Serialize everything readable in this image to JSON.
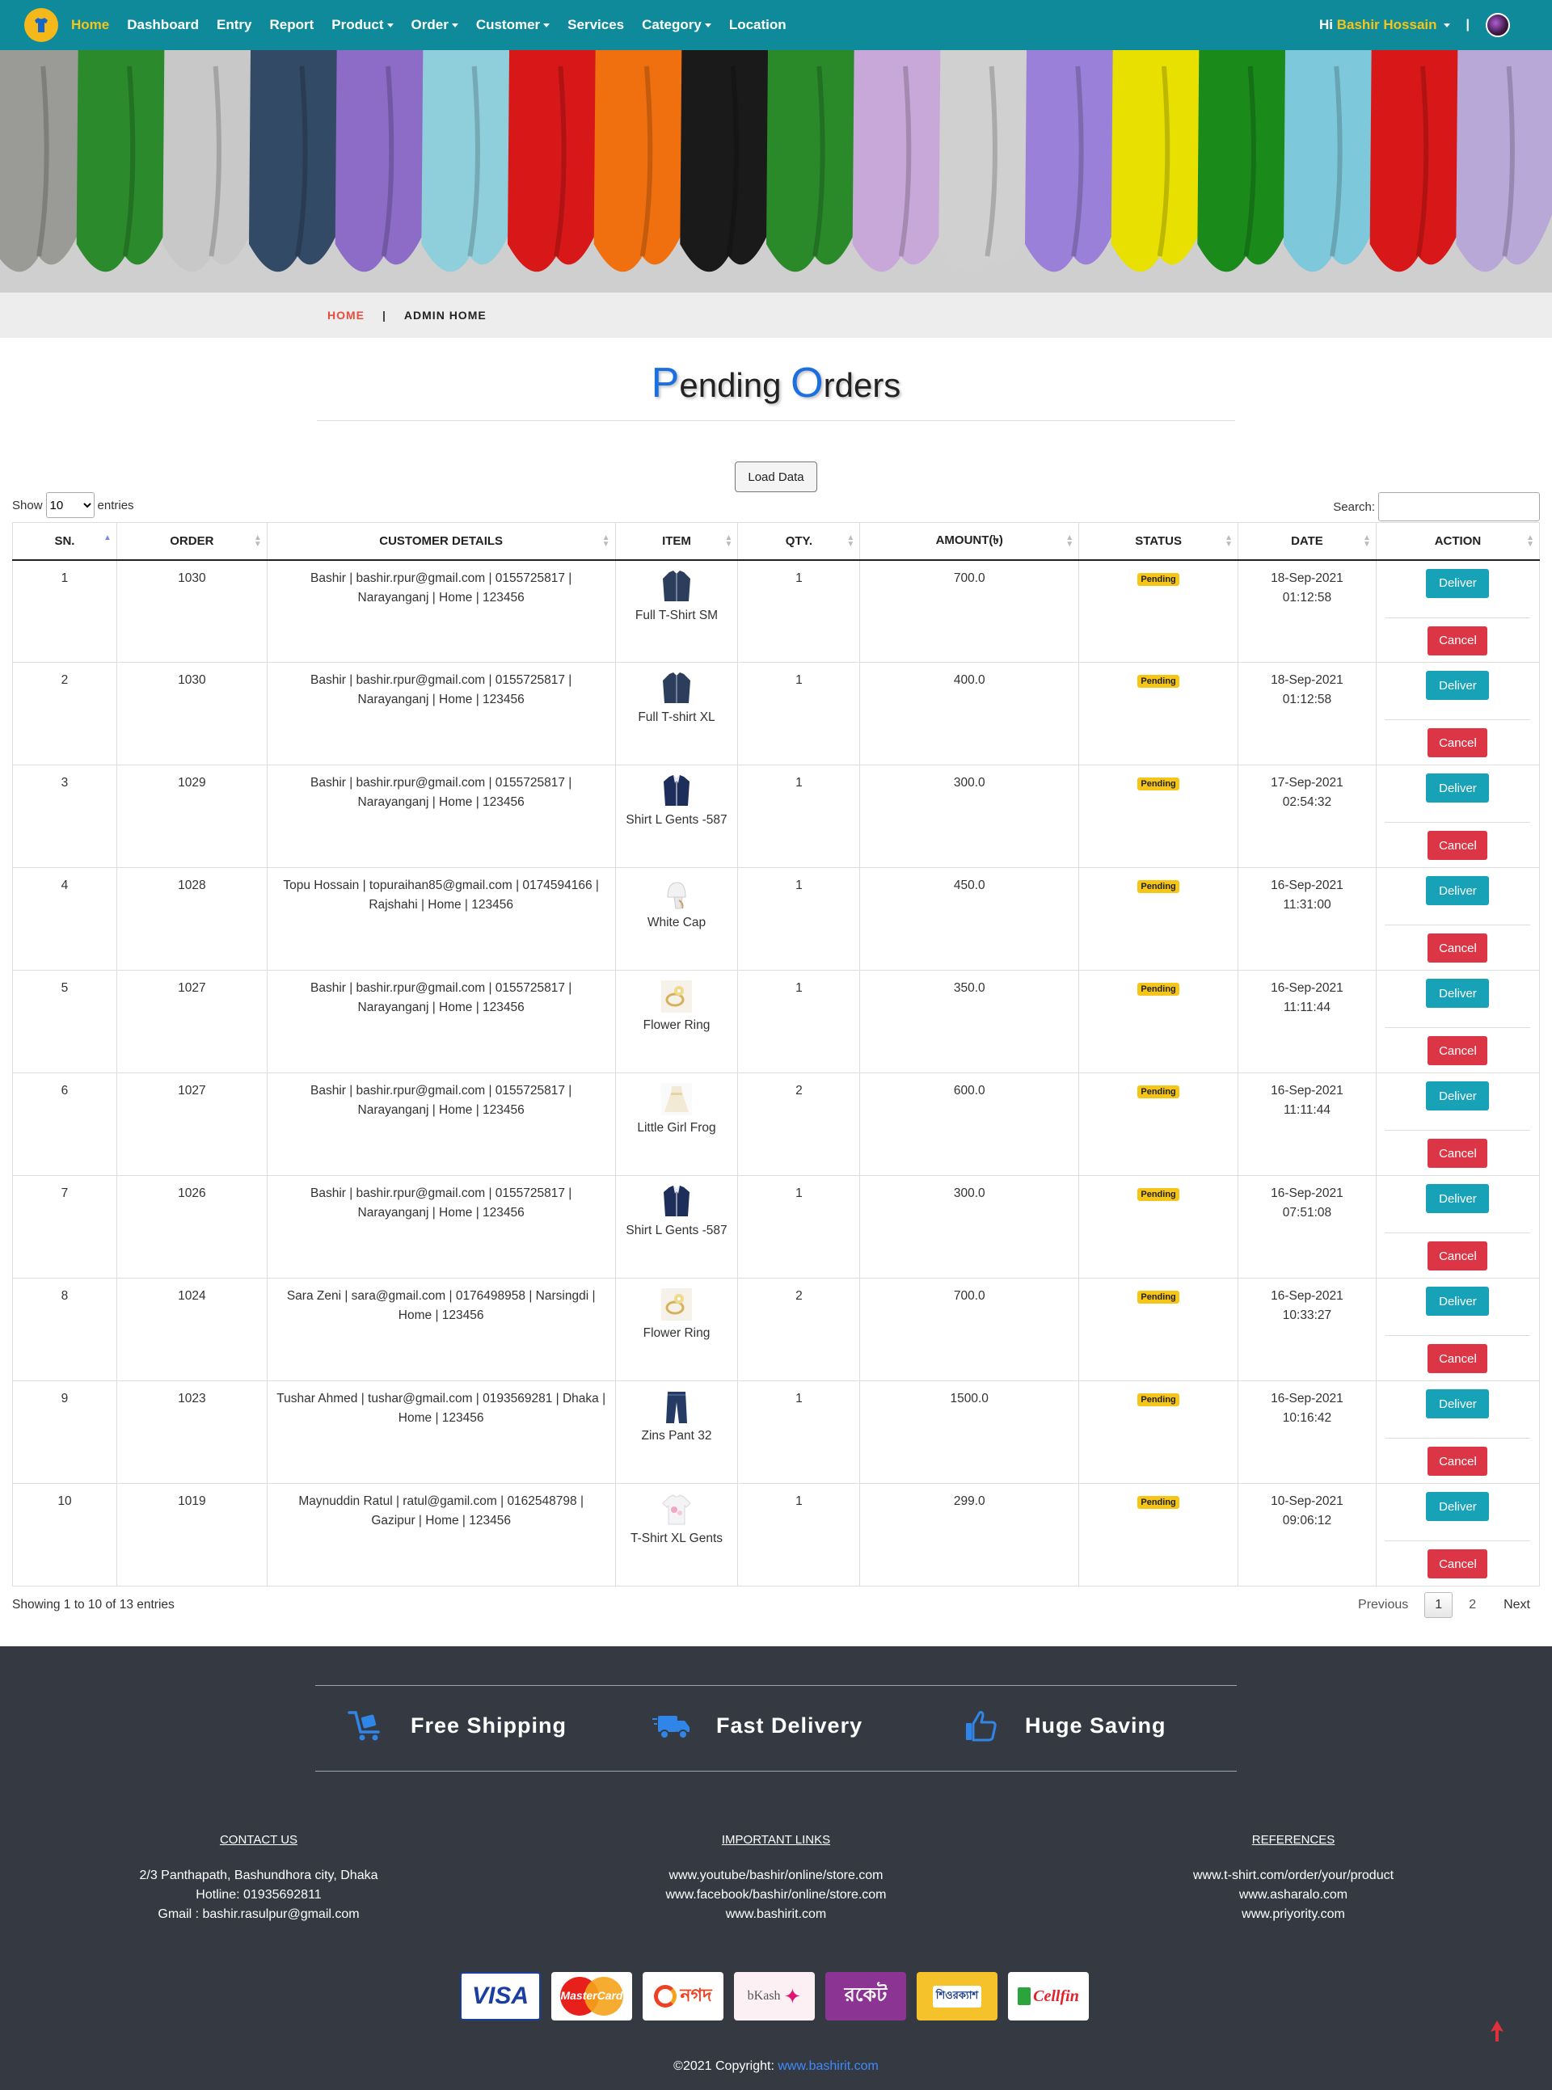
{
  "nav": {
    "items": [
      {
        "label": "Home",
        "active": true,
        "dropdown": false
      },
      {
        "label": "Dashboard",
        "active": false,
        "dropdown": false
      },
      {
        "label": "Entry",
        "active": false,
        "dropdown": false
      },
      {
        "label": "Report",
        "active": false,
        "dropdown": false
      },
      {
        "label": "Product",
        "active": false,
        "dropdown": true
      },
      {
        "label": "Order",
        "active": false,
        "dropdown": true
      },
      {
        "label": "Customer",
        "active": false,
        "dropdown": true
      },
      {
        "label": "Services",
        "active": false,
        "dropdown": false
      },
      {
        "label": "Category",
        "active": false,
        "dropdown": true
      },
      {
        "label": "Location",
        "active": false,
        "dropdown": false
      }
    ],
    "greeting": "Hi",
    "user_name": "Bashir Hossain",
    "separator": "|"
  },
  "breadcrumb": {
    "home": "HOME",
    "separator": "|",
    "current": "ADMIN HOME"
  },
  "title": {
    "first_cap": "P",
    "first_rest": "ending ",
    "second_cap": "O",
    "second_rest": "rders"
  },
  "load_button": "Load Data",
  "table_controls": {
    "show_label": "Show",
    "entries_value": "10",
    "entries_label": "entries",
    "search_label": "Search:",
    "search_value": ""
  },
  "columns": [
    "SN.",
    "ORDER",
    "CUSTOMER DETAILS",
    "ITEM",
    "QTY.",
    "AMOUNT(৳)",
    "STATUS",
    "DATE",
    "ACTION"
  ],
  "rows": [
    {
      "sn": "1",
      "order": "1030",
      "customer": "Bashir | bashir.rpur@gmail.com | 0155725817 | Narayanganj | Home | 123456",
      "item": "Full T-Shirt SM",
      "icon": "jacket-icon",
      "qty": "1",
      "amount": "700.0",
      "status": "Pending",
      "date": "18-Sep-2021",
      "time": "01:12:58"
    },
    {
      "sn": "2",
      "order": "1030",
      "customer": "Bashir | bashir.rpur@gmail.com | 0155725817 | Narayanganj | Home | 123456",
      "item": "Full T-shirt XL",
      "icon": "jacket-icon",
      "qty": "1",
      "amount": "400.0",
      "status": "Pending",
      "date": "18-Sep-2021",
      "time": "01:12:58"
    },
    {
      "sn": "3",
      "order": "1029",
      "customer": "Bashir | bashir.rpur@gmail.com | 0155725817 | Narayanganj | Home | 123456",
      "item": "Shirt L Gents -587",
      "icon": "shirt-icon",
      "qty": "1",
      "amount": "300.0",
      "status": "Pending",
      "date": "17-Sep-2021",
      "time": "02:54:32"
    },
    {
      "sn": "4",
      "order": "1028",
      "customer": "Topu Hossain | topuraihan85@gmail.com | 0174594166 | Rajshahi | Home | 123456",
      "item": "White Cap",
      "icon": "cap-icon",
      "qty": "1",
      "amount": "450.0",
      "status": "Pending",
      "date": "16-Sep-2021",
      "time": "11:31:00"
    },
    {
      "sn": "5",
      "order": "1027",
      "customer": "Bashir | bashir.rpur@gmail.com | 0155725817 | Narayanganj | Home | 123456",
      "item": "Flower Ring",
      "icon": "ring-icon",
      "qty": "1",
      "amount": "350.0",
      "status": "Pending",
      "date": "16-Sep-2021",
      "time": "11:11:44"
    },
    {
      "sn": "6",
      "order": "1027",
      "customer": "Bashir | bashir.rpur@gmail.com | 0155725817 | Narayanganj | Home | 123456",
      "item": "Little Girl Frog",
      "icon": "dress-icon",
      "qty": "2",
      "amount": "600.0",
      "status": "Pending",
      "date": "16-Sep-2021",
      "time": "11:11:44"
    },
    {
      "sn": "7",
      "order": "1026",
      "customer": "Bashir | bashir.rpur@gmail.com | 0155725817 | Narayanganj | Home | 123456",
      "item": "Shirt L Gents -587",
      "icon": "shirt-icon",
      "qty": "1",
      "amount": "300.0",
      "status": "Pending",
      "date": "16-Sep-2021",
      "time": "07:51:08"
    },
    {
      "sn": "8",
      "order": "1024",
      "customer": "Sara Zeni | sara@gmail.com | 0176498958 | Narsingdi | Home | 123456",
      "item": "Flower Ring",
      "icon": "ring-icon",
      "qty": "2",
      "amount": "700.0",
      "status": "Pending",
      "date": "16-Sep-2021",
      "time": "10:33:27"
    },
    {
      "sn": "9",
      "order": "1023",
      "customer": "Tushar Ahmed | tushar@gmail.com | 0193569281 | Dhaka | Home | 123456",
      "item": "Zins Pant 32",
      "icon": "jeans-icon",
      "qty": "1",
      "amount": "1500.0",
      "status": "Pending",
      "date": "16-Sep-2021",
      "time": "10:16:42"
    },
    {
      "sn": "10",
      "order": "1019",
      "customer": "Maynuddin Ratul | ratul@gamil.com | 0162548798 | Gazipur | Home | 123456",
      "item": "T-Shirt XL Gents",
      "icon": "tshirt-icon",
      "qty": "1",
      "amount": "299.0",
      "status": "Pending",
      "date": "10-Sep-2021",
      "time": "09:06:12"
    }
  ],
  "row_actions": {
    "deliver": "Deliver",
    "cancel": "Cancel"
  },
  "table_info": "Showing 1 to 10 of 13 entries",
  "pagination": {
    "previous": "Previous",
    "pages": [
      "1",
      "2"
    ],
    "current": "1",
    "next": "Next"
  },
  "features": [
    {
      "label": "Free Shipping",
      "icon": "cart-icon"
    },
    {
      "label": "Fast Delivery",
      "icon": "truck-icon"
    },
    {
      "label": "Huge Saving",
      "icon": "thumbs-up-icon"
    }
  ],
  "footer": {
    "contact": {
      "heading": "CONTACT US",
      "lines": [
        "2/3 Panthapath, Bashundhora city, Dhaka",
        "Hotline: 01935692811",
        "Gmail : bashir.rasulpur@gmail.com"
      ]
    },
    "links": {
      "heading": "IMPORTANT LINKS",
      "lines": [
        "www.youtube/bashir/online/store.com",
        "www.facebook/bashir/online/store.com",
        "www.bashirit.com"
      ]
    },
    "references": {
      "heading": "REFERENCES",
      "lines": [
        "www.t-shirt.com/order/your/product",
        "www.asharalo.com",
        "www.priyority.com"
      ]
    },
    "payments": [
      "VISA",
      "MasterCard",
      "নগদ",
      "bKash",
      "রকেট",
      "শিওরক্যাশ",
      "Cellfin"
    ],
    "copyright": "©2021 Copyright:",
    "copyright_link": "www.bashirit.com"
  },
  "colors": {
    "navbar": "#0f8a9b",
    "accent": "#f5c518",
    "deliver": "#17a2b8",
    "cancel": "#dc3545",
    "footer": "#353a42"
  }
}
